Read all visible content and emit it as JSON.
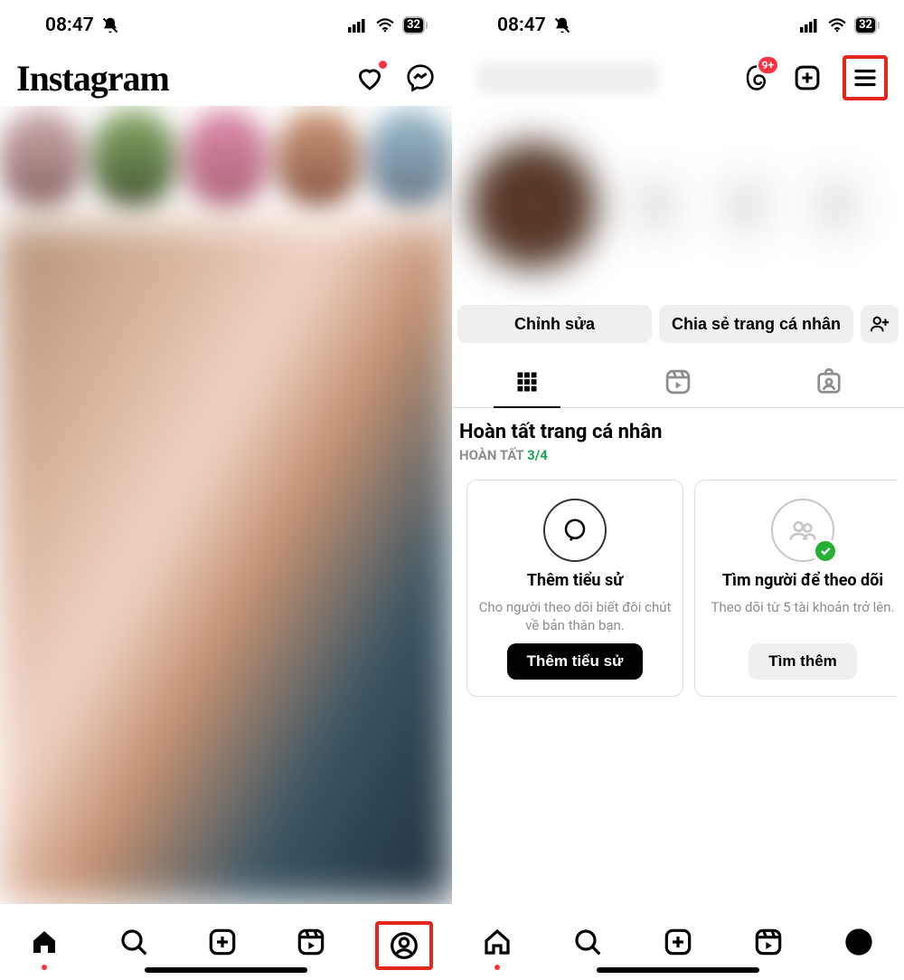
{
  "status": {
    "time": "08:47",
    "battery": "32"
  },
  "left": {
    "logo": "Instagram",
    "threads_badge": "9+"
  },
  "profile": {
    "edit_btn": "Chỉnh sửa",
    "share_btn": "Chia sẻ trang cá nhân",
    "complete_title": "Hoàn tất trang cá nhân",
    "complete_sub_prefix": "HOÀN TẤT ",
    "complete_sub_count": "3/4",
    "cards": [
      {
        "title": "Thêm tiểu sử",
        "desc": "Cho người theo dõi biết đôi chút về bản thân bạn.",
        "btn": "Thêm tiểu sử"
      },
      {
        "title": "Tìm người để theo dõi",
        "desc": "Theo dõi từ 5 tài khoản trở lên.",
        "btn": "Tìm thêm"
      }
    ]
  }
}
